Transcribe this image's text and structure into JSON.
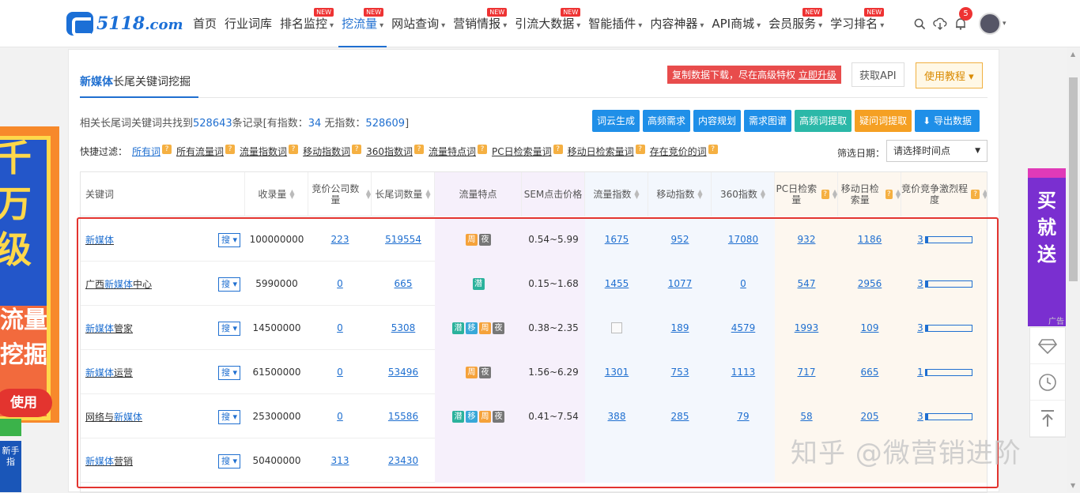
{
  "logo": {
    "text": "5118",
    "suffix": ".com"
  },
  "nav": [
    {
      "label": "首页",
      "caret": false,
      "new": false
    },
    {
      "label": "行业词库",
      "caret": false,
      "new": false
    },
    {
      "label": "排名监控",
      "caret": true,
      "new": true
    },
    {
      "label": "挖流量",
      "caret": true,
      "new": true,
      "active": true
    },
    {
      "label": "网站查询",
      "caret": true,
      "new": false
    },
    {
      "label": "营销情报",
      "caret": true,
      "new": true
    },
    {
      "label": "引流大数据",
      "caret": true,
      "new": true
    },
    {
      "label": "智能插件",
      "caret": true,
      "new": false
    },
    {
      "label": "内容神器",
      "caret": true,
      "new": false
    },
    {
      "label": "API商城",
      "caret": true,
      "new": false
    },
    {
      "label": "会员服务",
      "caret": true,
      "new": true
    },
    {
      "label": "学习排名",
      "caret": true,
      "new": true
    }
  ],
  "new_badge": "NEW",
  "notification_count": "5",
  "panel": {
    "title_highlight": "新媒体",
    "title_rest": "长尾关键词挖掘",
    "upgrade_text": "复制数据下载，尽在高级特权",
    "upgrade_link": "立即升级",
    "api_button": "获取API",
    "tutorial_button": "使用教程 ▾"
  },
  "summary": {
    "prefix": "相关长尾词关键词共找到",
    "total": "528643",
    "mid": "条记录[有指数：",
    "with_index": "34",
    "mid2": " 无指数：",
    "without_index": "528609",
    "suffix": "]"
  },
  "actions": [
    "词云生成",
    "高频需求",
    "内容规划",
    "需求图谱",
    "高频词提取",
    "疑问词提取",
    "导出数据"
  ],
  "filters": {
    "label": "快捷过滤：",
    "items": [
      "所有词",
      "所有流量词",
      "流量指数词",
      "移动指数词",
      "360指数词",
      "流量特点词",
      "PC日检索量词",
      "移动日检索量词",
      "存在竞价的词"
    ]
  },
  "date": {
    "label": "筛选日期：",
    "placeholder": "请选择时间点"
  },
  "columns": [
    "关键词",
    "收录量",
    "竞价公司数量",
    "长尾词数量",
    "流量特点",
    "SEM点击价格",
    "流量指数",
    "移动指数",
    "360指数",
    "PC日检索量",
    "移动日检索量",
    "竞价竞争激烈程度"
  ],
  "search_btn": "搜",
  "rows": [
    {
      "kw_pre": "",
      "kw_hl": "新媒体",
      "kw_post": "",
      "indexed": "100000000",
      "companies": "223",
      "longtail": "519554",
      "tags": [
        "周",
        "夜"
      ],
      "sem": "0.54~5.99",
      "flow": "1675",
      "mobile": "952",
      "i360": "17080",
      "pc": "932",
      "mday": "1186",
      "comp": "3",
      "fill": 0.06
    },
    {
      "kw_pre": "广西",
      "kw_hl": "新媒体",
      "kw_post": "中心",
      "indexed": "5990000",
      "companies": "0",
      "longtail": "665",
      "tags": [
        "潜"
      ],
      "sem": "0.15~1.68",
      "flow": "1455",
      "mobile": "1077",
      "i360": "0",
      "pc": "547",
      "mday": "2956",
      "comp": "3",
      "fill": 0.06
    },
    {
      "kw_pre": "",
      "kw_hl": "新媒体",
      "kw_post": "管家",
      "indexed": "14500000",
      "companies": "0",
      "longtail": "5308",
      "tags": [
        "潜",
        "移",
        "周",
        "夜"
      ],
      "sem": "0.38~2.35",
      "flow": "",
      "mobile": "189",
      "i360": "4579",
      "pc": "1993",
      "mday": "109",
      "comp": "3",
      "fill": 0.06
    },
    {
      "kw_pre": "",
      "kw_hl": "新媒体",
      "kw_post": "运营",
      "indexed": "61500000",
      "companies": "0",
      "longtail": "53496",
      "tags": [
        "周",
        "夜"
      ],
      "sem": "1.56~6.29",
      "flow": "1301",
      "mobile": "753",
      "i360": "1113",
      "pc": "717",
      "mday": "665",
      "comp": "1",
      "fill": 0.03
    },
    {
      "kw_pre": "网络与",
      "kw_hl": "新媒体",
      "kw_post": "",
      "indexed": "25300000",
      "companies": "0",
      "longtail": "15586",
      "tags": [
        "潜",
        "移",
        "周",
        "夜"
      ],
      "sem": "0.41~7.54",
      "flow": "388",
      "mobile": "285",
      "i360": "79",
      "pc": "58",
      "mday": "205",
      "comp": "3",
      "fill": 0.06
    },
    {
      "kw_pre": "",
      "kw_hl": "新媒体",
      "kw_post": "营销",
      "indexed": "50400000",
      "companies": "313",
      "longtail": "23430",
      "tags": [],
      "sem": "",
      "flow": "",
      "mobile": "",
      "i360": "",
      "pc": "",
      "mday": "",
      "comp": "",
      "fill": 0
    }
  ],
  "left_ad": {
    "line1": "千",
    "line2": "万",
    "line3": "级",
    "line4": "流量",
    "line5": "挖掘",
    "button": "使用"
  },
  "left_tab": "新手指",
  "right_ad": {
    "text": "买就送",
    "label": "广告"
  },
  "watermark": "知乎 @微营销进阶",
  "colors": {
    "brand": "#1f6fd0",
    "highlight_box": "#e3342f",
    "new_badge": "#e33"
  }
}
